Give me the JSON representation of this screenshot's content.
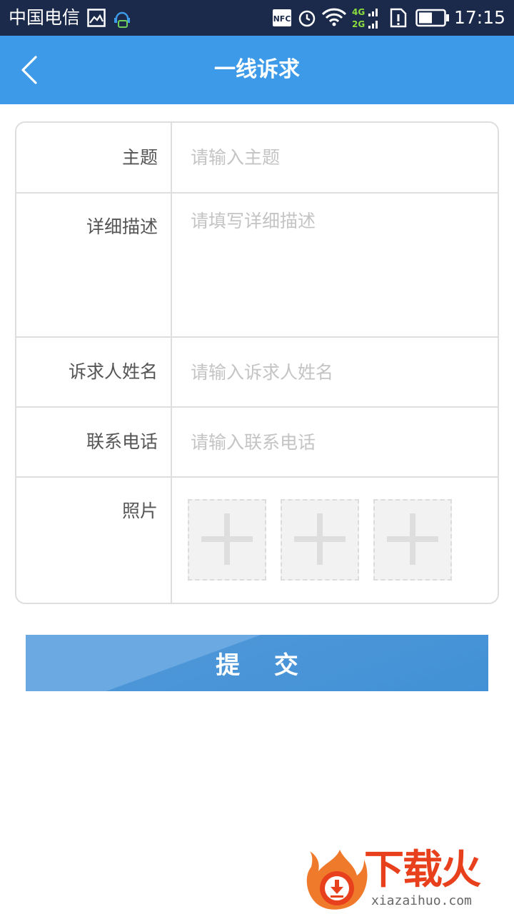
{
  "status_bar": {
    "carrier": "中国电信",
    "icons": [
      "image-icon",
      "chat-bot-icon",
      "nfc-icon",
      "alarm-icon",
      "wifi-icon",
      "4g-2g-signal-icon",
      "sim-alert-icon",
      "battery-icon"
    ],
    "nfc_label": "NFC",
    "net_4g": "4G",
    "net_2g": "2G",
    "time": "17:15"
  },
  "header": {
    "title": "一线诉求",
    "back_icon": "chevron-left-icon",
    "bg_color": "#3d9ae8"
  },
  "form": {
    "subject": {
      "label": "主题",
      "placeholder": "请输入主题",
      "value": ""
    },
    "description": {
      "label": "详细描述",
      "placeholder": "请填写详细描述",
      "value": ""
    },
    "name": {
      "label": "诉求人姓名",
      "placeholder": "请输入诉求人姓名",
      "value": ""
    },
    "phone": {
      "label": "联系电话",
      "placeholder": "请输入联系电话",
      "value": ""
    },
    "photos": {
      "label": "照片",
      "slot_icon": "plus-icon"
    }
  },
  "submit": {
    "label": "提 交",
    "color": "#4291d6"
  },
  "watermark": {
    "logo_icon": "flame-download-logo-icon",
    "title": "下载火",
    "url": "xiazaihuo.com",
    "color": "#e8401c"
  }
}
